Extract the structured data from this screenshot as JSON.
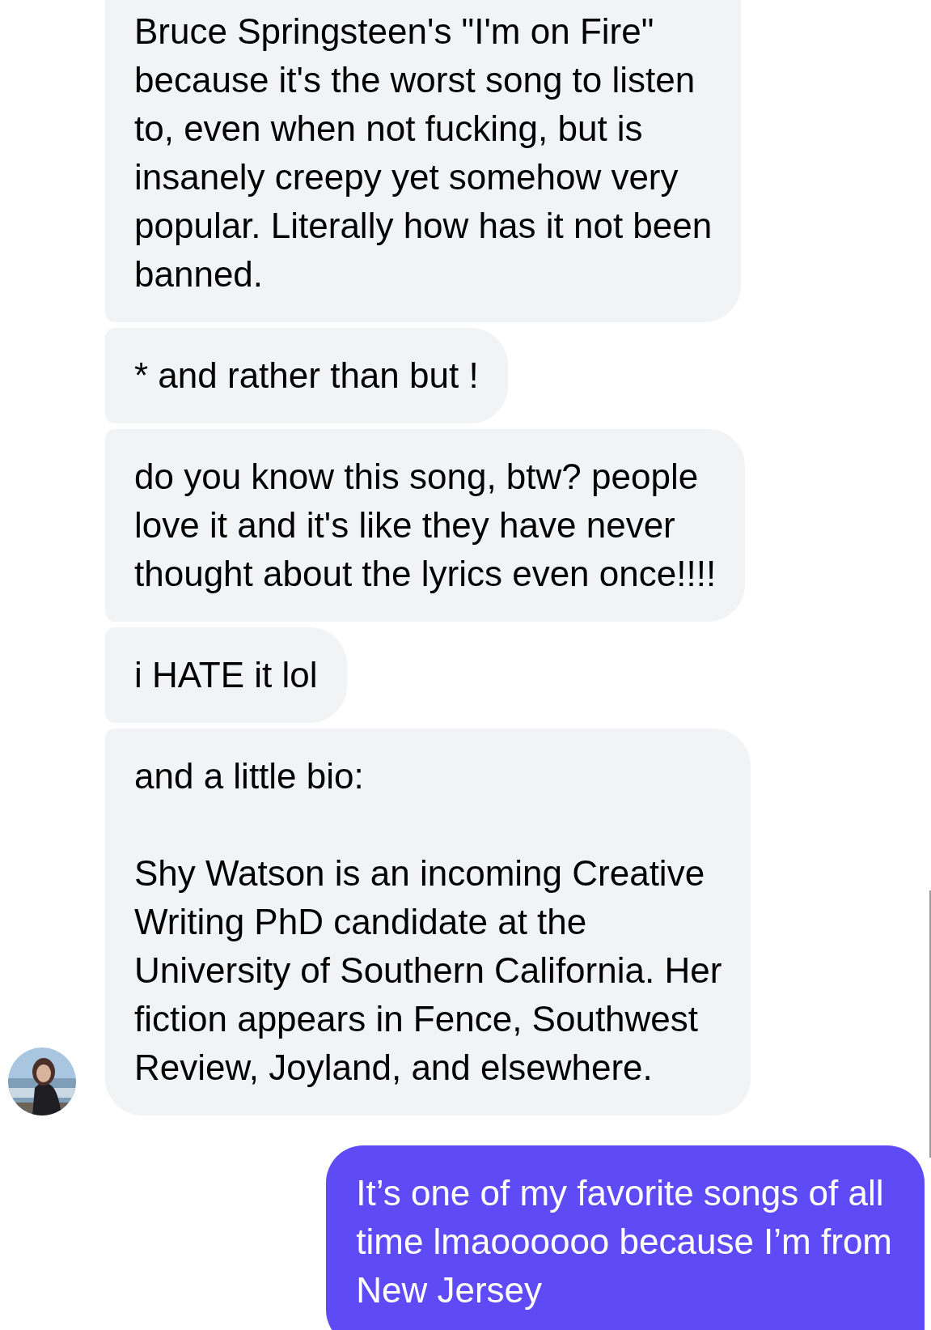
{
  "messages": [
    {
      "kind": "received",
      "text": "Bruce Springsteen's \"I'm on Fire\"\nbecause it's the worst song to listen\nto, even when not fucking, but is\ninsanely creepy yet somehow very\npopular. Literally how has it not been\nbanned."
    },
    {
      "kind": "received",
      "text": "* and rather than but !"
    },
    {
      "kind": "received",
      "text": "do you know this song, btw? people\nlove it and it's like they have never\nthought about the lyrics even once!!!!"
    },
    {
      "kind": "received",
      "text": "i HATE it lol"
    },
    {
      "kind": "received",
      "text": "and a little bio:\n\nShy Watson is an incoming Creative\nWriting PhD candidate at the\nUniversity of Southern California. Her\nfiction appears in Fence, Southwest\nReview, Joyland, and elsewhere."
    },
    {
      "kind": "sent",
      "text": "It’s one of my favorite songs of all\ntime lmaoooooo because I’m from\nNew Jersey"
    }
  ]
}
